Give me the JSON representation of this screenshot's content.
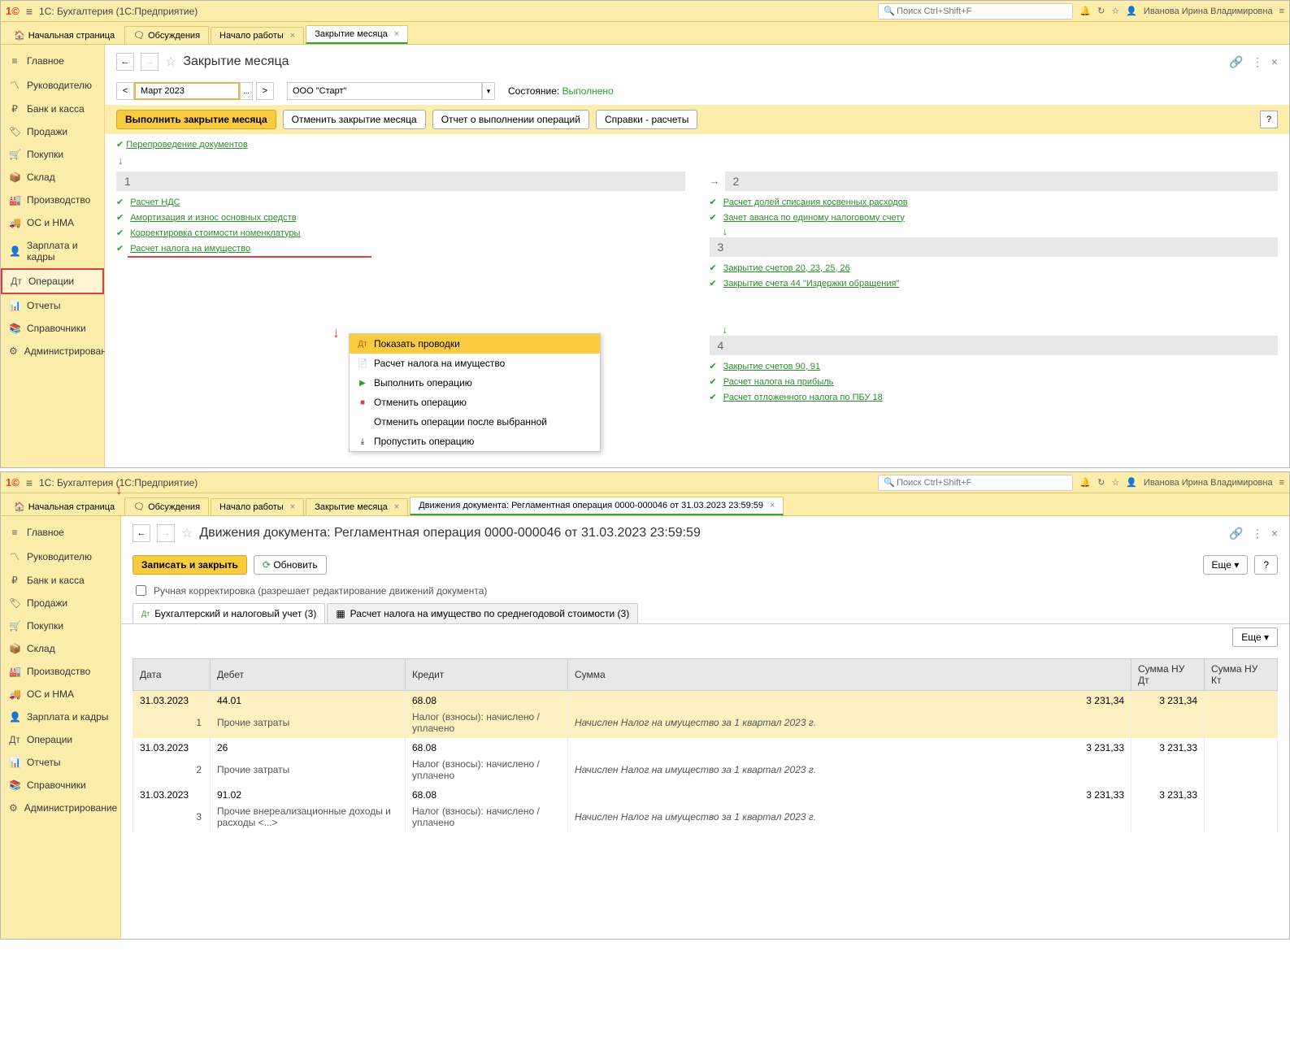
{
  "app": {
    "logo": "1C",
    "title": "1С: Бухгалтерия  (1С:Предприятие)",
    "search_placeholder": "Поиск Ctrl+Shift+F",
    "user": "Иванова Ирина Владимировна"
  },
  "tabs_top": {
    "home": "Начальная страница",
    "discuss": "Обсуждения",
    "t1": "Начало работы",
    "t2": "Закрытие месяца"
  },
  "sidebar": {
    "main": "Главное",
    "lead": "Руководителю",
    "bank": "Банк и касса",
    "sales": "Продажи",
    "buy": "Покупки",
    "stock": "Склад",
    "prod": "Производство",
    "os": "ОС и НМА",
    "hr": "Зарплата и кадры",
    "ops": "Операции",
    "reports": "Отчеты",
    "ref": "Справочники",
    "admin": "Администрирование"
  },
  "closing": {
    "title": "Закрытие месяца",
    "period": "Март 2023",
    "org": "ООО \"Старт\"",
    "state_label": "Состояние:",
    "state_value": "Выполнено",
    "btn_run": "Выполнить закрытие месяца",
    "btn_cancel": "Отменить закрытие месяца",
    "btn_report": "Отчет о выполнении операций",
    "btn_help": "Справки - расчеты",
    "repost": "Перепроведение документов",
    "s1_1": "Расчет НДС",
    "s1_2": "Амортизация и износ основных средств",
    "s1_3": "Корректировка стоимости номенклатуры",
    "s1_4": "Расчет налога на имущество",
    "s2_1": "Расчет долей списания косвенных расходов",
    "s2_2": "Зачет аванса по единому налоговому счету",
    "s3_1": "Закрытие счетов 20, 23, 25, 26",
    "s3_2": "Закрытие счета 44 \"Издержки обращения\"",
    "s4_1": "Закрытие счетов 90, 91",
    "s4_2": "Расчет налога на прибыль",
    "s4_3": "Расчет отложенного налога по ПБУ 18"
  },
  "ctx": {
    "i1": "Показать проводки",
    "i2": "Расчет налога на имущество",
    "i3": "Выполнить операцию",
    "i4": "Отменить операцию",
    "i5": "Отменить операции после выбранной",
    "i6": "Пропустить операцию"
  },
  "doc": {
    "title": "Движения документа: Регламентная операция 0000-000046 от 31.03.2023 23:59:59",
    "tab_label": "Движения документа: Регламентная операция 0000-000046 от 31.03.2023 23:59:59",
    "btn_save": "Записать и закрыть",
    "btn_refresh": "Обновить",
    "btn_more": "Еще",
    "chk_manual": "Ручная корректировка (разрешает редактирование движений документа)",
    "tab1": "Бухгалтерский и налоговый учет (3)",
    "tab2": "Расчет налога на имущество по среднегодовой стоимости (3)",
    "cols": {
      "date": "Дата",
      "debit": "Дебет",
      "credit": "Кредит",
      "sum": "Сумма",
      "nud": "Сумма НУ Дт",
      "nuk": "Сумма НУ Кт"
    },
    "rows": [
      {
        "date": "31.03.2023",
        "n": "1",
        "debit": "44.01",
        "debit_sub": "Прочие затраты",
        "credit": "68.08",
        "credit_sub": "Налог (взносы): начислено / уплачено",
        "sum": "3 231,34",
        "sum_sub": "Начислен Налог на имущество за 1 квартал 2023 г.",
        "nud": "3 231,34",
        "nuk": ""
      },
      {
        "date": "31.03.2023",
        "n": "2",
        "debit": "26",
        "debit_sub": "Прочие затраты",
        "credit": "68.08",
        "credit_sub": "Налог (взносы): начислено / уплачено",
        "sum": "3 231,33",
        "sum_sub": "Начислен Налог на имущество за 1 квартал 2023 г.",
        "nud": "3 231,33",
        "nuk": ""
      },
      {
        "date": "31.03.2023",
        "n": "3",
        "debit": "91.02",
        "debit_sub": "Прочие внереализационные доходы и расходы <...>",
        "credit": "68.08",
        "credit_sub": "Налог (взносы): начислено / уплачено",
        "sum": "3 231,33",
        "sum_sub": "Начислен Налог на имущество за 1 квартал 2023 г.",
        "nud": "3 231,33",
        "nuk": ""
      }
    ]
  }
}
